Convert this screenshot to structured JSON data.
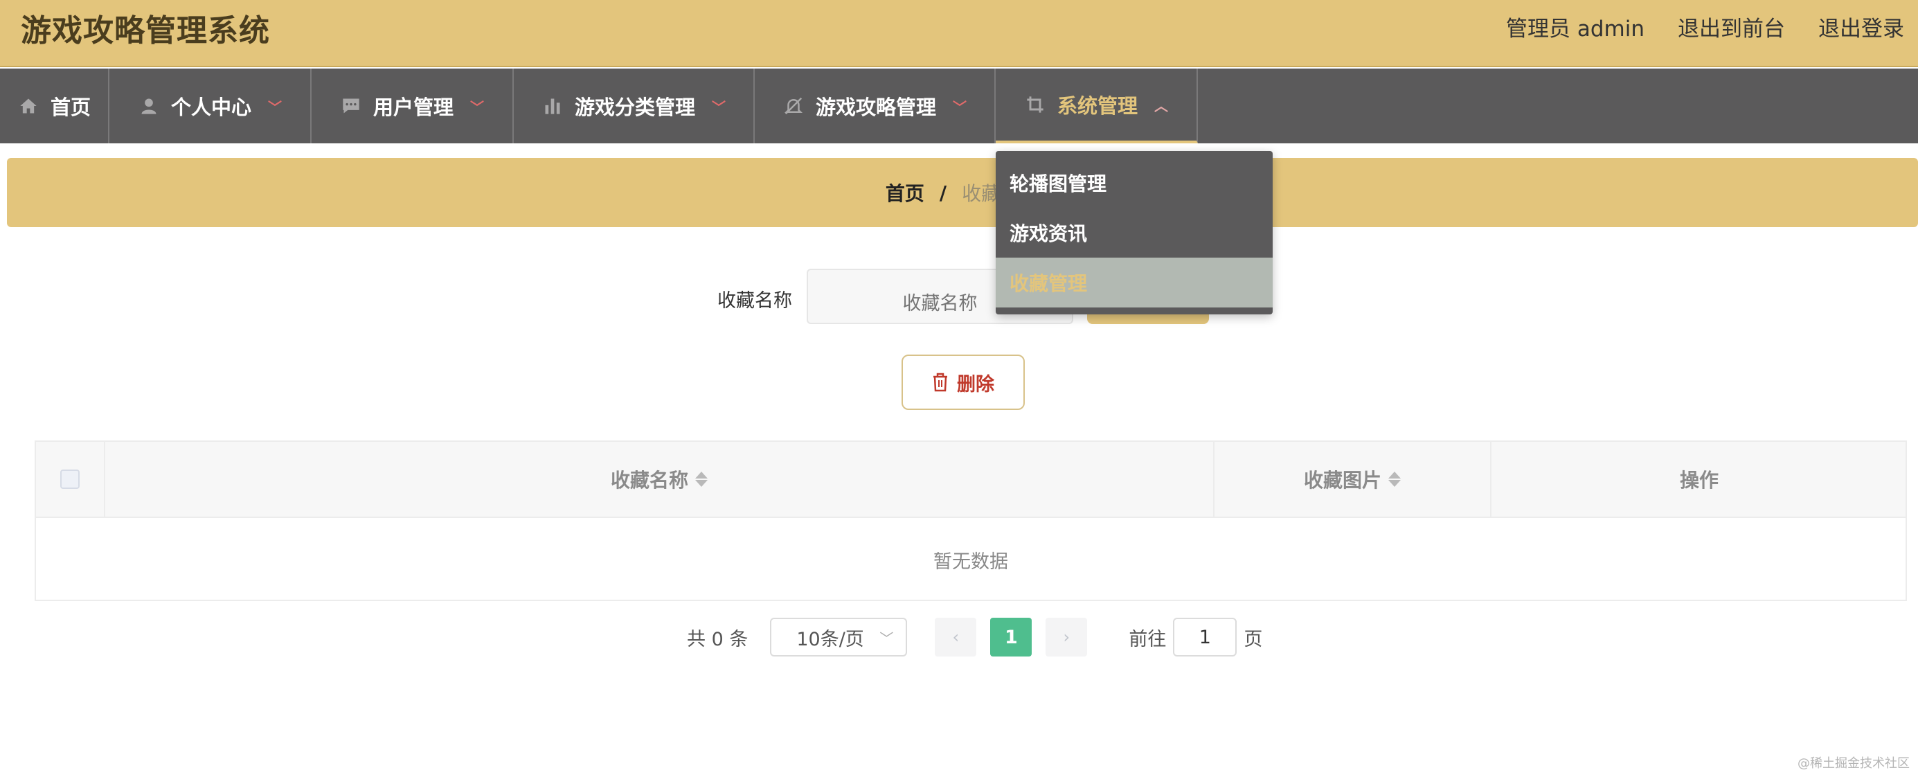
{
  "app": {
    "title": "游戏攻略管理系统"
  },
  "header": {
    "admin_label": "管理员 admin",
    "to_front": "退出到前台",
    "logout": "退出登录"
  },
  "nav": {
    "items": [
      {
        "label": "首页",
        "icon": "home-icon"
      },
      {
        "label": "个人中心",
        "icon": "user-icon"
      },
      {
        "label": "用户管理",
        "icon": "chat-icon"
      },
      {
        "label": "游戏分类管理",
        "icon": "bar-chart-icon"
      },
      {
        "label": "游戏攻略管理",
        "icon": "bell-off-icon"
      },
      {
        "label": "系统管理",
        "icon": "crop-icon",
        "active": true
      }
    ]
  },
  "dropdown": {
    "items": [
      {
        "label": "轮播图管理"
      },
      {
        "label": "游戏资讯"
      },
      {
        "label": "收藏管理",
        "active": true
      }
    ]
  },
  "breadcrumb": {
    "home": "首页",
    "separator": "/",
    "current": "收藏管理"
  },
  "search": {
    "label": "收藏名称",
    "placeholder": "收藏名称"
  },
  "actions": {
    "delete": "删除"
  },
  "table": {
    "columns": [
      "收藏名称",
      "收藏图片",
      "操作"
    ],
    "empty_text": "暂无数据"
  },
  "pagination": {
    "total": "共 0 条",
    "page_size": "10条/页",
    "current_page": "1",
    "goto_label": "前往",
    "goto_value": "1",
    "page_suffix": "页"
  },
  "watermark": "@稀土掘金技术社区",
  "colors": {
    "header_bg": "#e3c57c",
    "nav_bg": "#5b5a5b",
    "accent": "#e3c57c",
    "pager_active": "#4fbe8e",
    "danger": "#c0392b"
  }
}
